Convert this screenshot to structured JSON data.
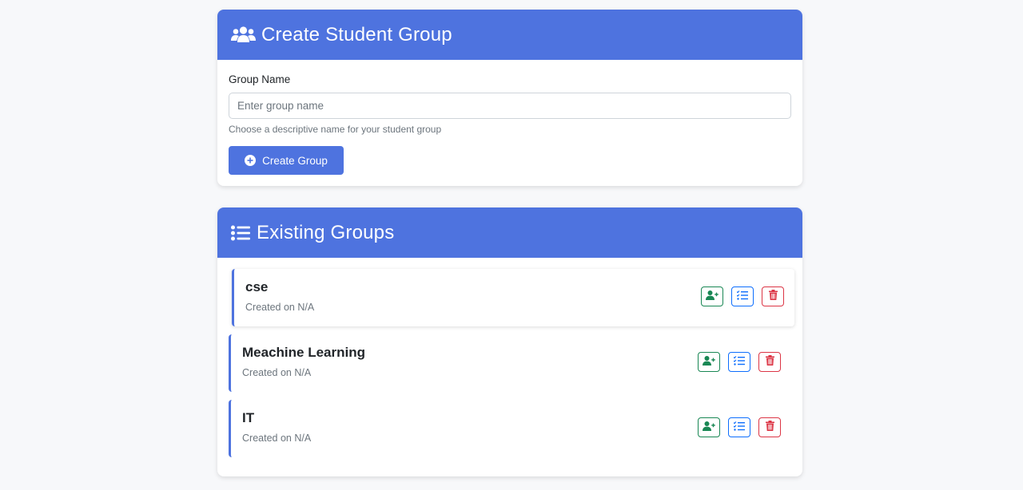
{
  "create": {
    "title": "Create Student Group",
    "label": "Group Name",
    "placeholder": "Enter group name",
    "value": "",
    "help": "Choose a descriptive name for your student group",
    "button_label": "Create Group"
  },
  "existing": {
    "title": "Existing Groups",
    "groups": [
      {
        "name": "cse",
        "created": "Created on N/A"
      },
      {
        "name": "Meachine Learning",
        "created": "Created on N/A"
      },
      {
        "name": "IT",
        "created": "Created on N/A"
      }
    ]
  },
  "icons": {
    "header_create": "users-icon",
    "header_list": "list-icon",
    "create_button": "plus-circle-icon",
    "add_member": "user-plus-icon",
    "manage_list": "list-check-icon",
    "delete": "trash-icon"
  },
  "colors": {
    "primary": "#4e73df",
    "success": "#198754",
    "info": "#0d6efd",
    "danger": "#dc3545"
  }
}
